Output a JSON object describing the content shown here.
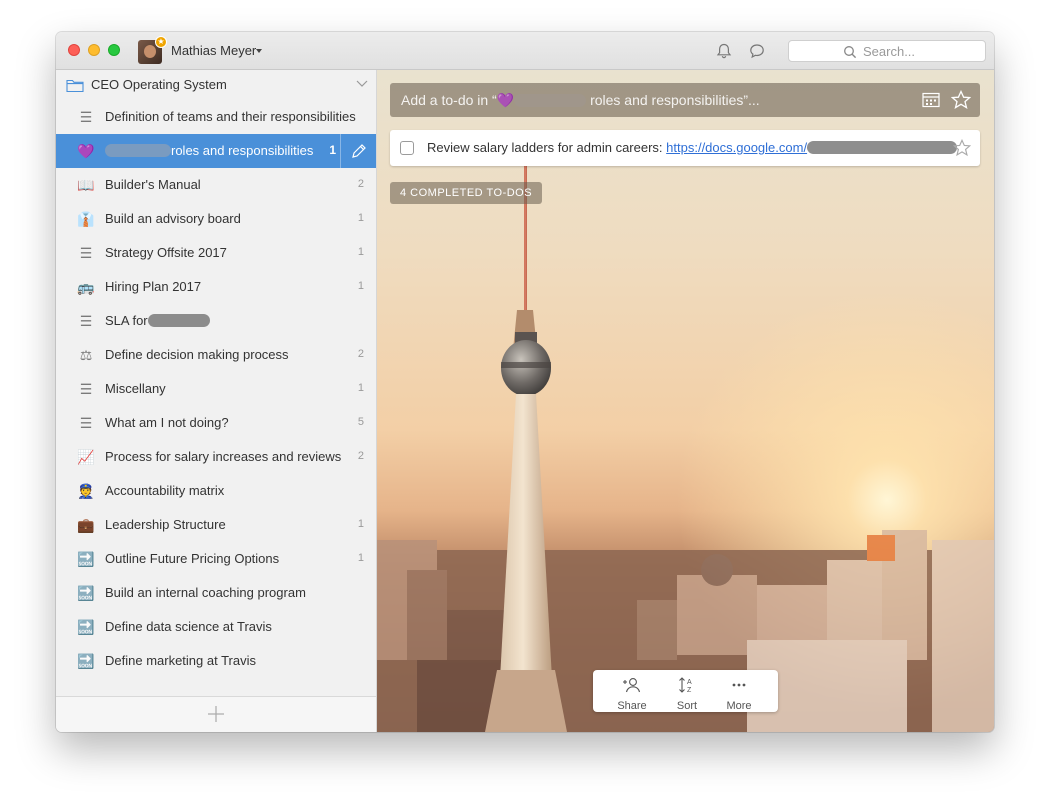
{
  "titlebar": {
    "user_name": "Mathias Meyer",
    "search_placeholder": "Search..."
  },
  "sidebar": {
    "group": {
      "label": "CEO Operating System",
      "icon": "folder-icon"
    },
    "items": [
      {
        "icon": "list-icon",
        "icon_glyph": "☰",
        "label": "Definition of teams and their responsibilities",
        "count": ""
      },
      {
        "icon": "purple-heart-icon",
        "icon_glyph": "💜",
        "label_suffix": "roles and responsibilities",
        "count": "1",
        "active": true
      },
      {
        "icon": "book-icon",
        "icon_glyph": "📖",
        "label": "Builder's Manual",
        "count": "2"
      },
      {
        "icon": "person-tie-icon",
        "icon_glyph": "👔",
        "label": "Build an advisory board",
        "count": "1"
      },
      {
        "icon": "list-icon",
        "icon_glyph": "☰",
        "label": "Strategy Offsite 2017",
        "count": "1"
      },
      {
        "icon": "bus-icon",
        "icon_glyph": "🚌",
        "label": "Hiring Plan 2017",
        "count": "1"
      },
      {
        "icon": "list-icon",
        "icon_glyph": "☰",
        "label_prefix": "SLA for",
        "count": ""
      },
      {
        "icon": "scales-icon",
        "icon_glyph": "⚖",
        "label": "Define decision making process",
        "count": "2"
      },
      {
        "icon": "list-icon",
        "icon_glyph": "☰",
        "label": "Miscellany",
        "count": "1"
      },
      {
        "icon": "list-icon",
        "icon_glyph": "☰",
        "label": "What am I not doing?",
        "count": "5"
      },
      {
        "icon": "chart-increasing-icon",
        "icon_glyph": "📈",
        "label": "Process for salary increases and reviews",
        "count": "2"
      },
      {
        "icon": "police-officer-icon",
        "icon_glyph": "👮",
        "label": "Accountability matrix",
        "count": ""
      },
      {
        "icon": "briefcase-icon",
        "icon_glyph": "💼",
        "label": "Leadership Structure",
        "count": "1"
      },
      {
        "icon": "soon-arrow-icon",
        "icon_glyph": "🔜",
        "label": "Outline Future Pricing Options",
        "count": "1"
      },
      {
        "icon": "soon-arrow-icon",
        "icon_glyph": "🔜",
        "label": "Build an internal coaching program",
        "count": ""
      },
      {
        "icon": "soon-arrow-icon",
        "icon_glyph": "🔜",
        "label": "Define data science at Travis",
        "count": ""
      },
      {
        "icon": "soon-arrow-icon",
        "icon_glyph": "🔜",
        "label": "Define marketing at Travis",
        "count": ""
      }
    ]
  },
  "main": {
    "add_todo": {
      "prefix": "Add a to-do in “",
      "suffix": "roles and responsibilities”..."
    },
    "todo": {
      "title": "Review salary ladders for admin careers: ",
      "link": "https://docs.google.com/"
    },
    "completed_label": "4 COMPLETED TO-DOS",
    "toolbar": [
      {
        "icon": "share-person-icon",
        "label": "Share"
      },
      {
        "icon": "sort-az-icon",
        "label": "Sort"
      },
      {
        "icon": "more-dots-icon",
        "label": "More"
      }
    ]
  },
  "colors": {
    "accent": "#4a90d9",
    "sidebar_bg": "#f1f1f1",
    "link": "#2f6fd6"
  }
}
